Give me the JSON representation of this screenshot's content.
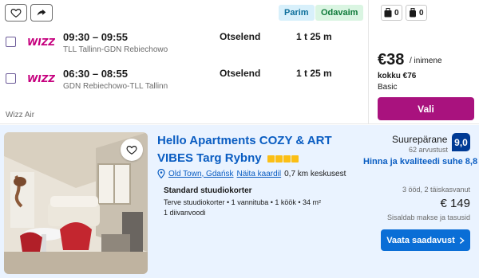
{
  "flight": {
    "tags": {
      "best": "Parim",
      "cheapest": "Odavaim"
    },
    "legs": [
      {
        "times": "09:30 – 09:55",
        "route": "TLL Tallinn-GDN Rebiechowo",
        "stops": "Otselend",
        "duration": "1 t 25 m"
      },
      {
        "times": "06:30 – 08:55",
        "route": "GDN Rebiechowo-TLL Tallinn",
        "stops": "Otselend",
        "duration": "1 t 25 m"
      }
    ],
    "airline_logo_text": "WIZZ",
    "airline": "Wizz Air",
    "bags": {
      "personal": "0",
      "cabin": "0"
    },
    "price": "€38",
    "price_per": "/ inimene",
    "price_total": "kokku €76",
    "fare_class": "Basic",
    "select_label": "Vali"
  },
  "hotel": {
    "name": "Hello Apartments COZY & ART VIBES Targ Rybny",
    "stars": 4,
    "location_link": "Old Town, Gdańsk",
    "map_link": "Näita kaardil",
    "distance": "0,7 km keskusest",
    "room_type": "Standard stuudiokorter",
    "room_desc": "Terve stuudiokorter • 1 vannituba • 1 köök • 34 m²",
    "room_beds": "1 diivanvoodi",
    "rating_word": "Suurepärane",
    "rating_count": "62 arvustust",
    "rating_score": "9,0",
    "value_text": "Hinna ja kvaliteedi suhe 8,8",
    "stay_info": "3 ööd, 2 täiskasvanut",
    "price": "€ 149",
    "tax_info": "Sisaldab makse ja tasusid",
    "availability_label": "Vaata saadavust"
  },
  "colors": {
    "wizz_magenta": "#a9127e",
    "booking_blue": "#0a6ed6",
    "score_navy": "#003b95",
    "star_yellow": "#fbbf16"
  },
  "icons": [
    "heart-icon",
    "share-icon",
    "personal-bag-icon",
    "cabin-bag-icon",
    "location-pin-icon",
    "chevron-right-icon"
  ]
}
